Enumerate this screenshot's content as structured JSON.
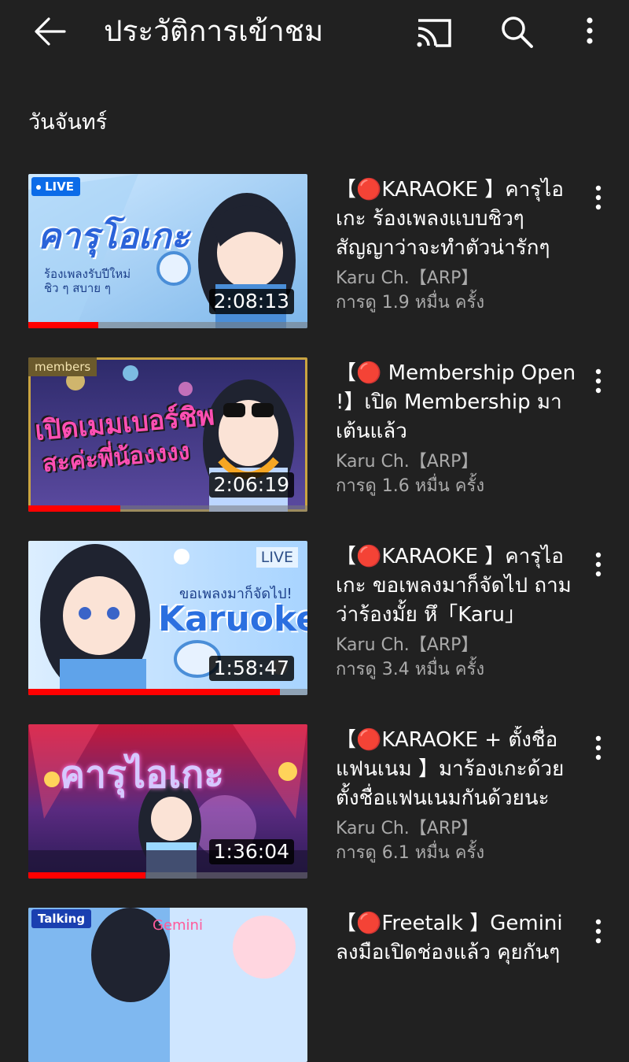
{
  "appbar": {
    "title": "ประวัติการเข้าชม",
    "back_icon": "arrow-back-icon",
    "cast_icon": "cast-icon",
    "search_icon": "search-icon",
    "more_icon": "more-vert-icon"
  },
  "section": {
    "title": "วันจันทร์"
  },
  "videos": [
    {
      "title": "【🔴KARAOKE 】คารุไอเกะ ร้องเพลงแบบชิวๆ สัญญาว่าจะทำตัวน่ารักๆ",
      "channel": "Karu Ch.【ARP】",
      "views": "การดู 1.9 หมื่น ครั้ง",
      "duration": "2:08:13",
      "badge": "LIVE",
      "progress": 0.25,
      "thumb_text": "คารุโอเกะ",
      "thumb_subtext": "ร้องเพลงรับปีใหม่ ชิว ๆ สบาย ๆ"
    },
    {
      "title": "【🔴 Membership Open !】เปิด Membership มาเต้นแล้ว",
      "channel": "Karu Ch.【ARP】",
      "views": "การดู 1.6 หมื่น ครั้ง",
      "duration": "2:06:19",
      "badge": "members",
      "progress": 0.33,
      "thumb_text": "เปิดเมมเบอร์ชิพ",
      "thumb_subtext": "สะค่ะพี่น้องงงง"
    },
    {
      "title": "【🔴KARAOKE 】คารุไอเกะ ขอเพลงมาก็จัดไป ถามว่าร้องมั้ย หึ「Karu」",
      "channel": "Karu Ch.【ARP】",
      "views": "การดู 3.4 หมื่น ครั้ง",
      "duration": "1:58:47",
      "badge": "LIVE",
      "progress": 0.9,
      "thumb_text": "Karuoke",
      "thumb_subtext": "ขอเพลงมาก็จัดไป!"
    },
    {
      "title": "【🔴KARAOKE + ตั้งชื่อแฟนเนม 】มาร้องเกะด้วย ตั้งชื่อแฟนเนมกันด้วยนะ",
      "channel": "Karu Ch.【ARP】",
      "views": "การดู 6.1 หมื่น ครั้ง",
      "duration": "1:36:04",
      "badge": "",
      "progress": 0.42,
      "thumb_text": "คารุไอเกะ",
      "thumb_subtext": ""
    },
    {
      "title": "【🔴Freetalk 】Gemini ลงมือเปิดช่องแล้ว คุยกันๆ",
      "channel": "",
      "views": "",
      "duration": "",
      "badge": "Talking",
      "progress": 0,
      "thumb_text": "Gemini",
      "thumb_subtext": ""
    }
  ]
}
